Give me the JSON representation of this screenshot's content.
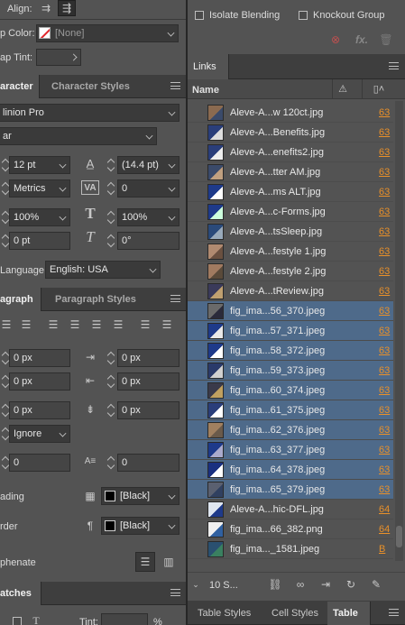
{
  "align": {
    "label": "Align:"
  },
  "gap": {
    "color_label": "p Color:",
    "color_value": "[None]",
    "tint_label": "ap Tint:"
  },
  "character": {
    "tab_active": "aracter",
    "tab_other": "Character Styles",
    "font_family": "linion Pro",
    "font_style": "ar",
    "size": "12 pt",
    "leading": "(14.4 pt)",
    "kerning": "Metrics",
    "tracking": "0",
    "vscale": "100%",
    "hscale": "100%",
    "baseline": "0 pt",
    "skew": "0°",
    "language_label": "Language:",
    "language_value": "English: USA"
  },
  "paragraph": {
    "tab_active": "agraph",
    "tab_other": "Paragraph Styles",
    "left_indent": "0 px",
    "right_indent": "0 px",
    "first_indent": "0 px",
    "last_indent": "0 px",
    "space_before": "0 px",
    "space_after": "0 px",
    "grid_align": "Ignore",
    "dropcap_lines": "0",
    "dropcap_chars": "0",
    "shading_label": "ading",
    "shading_color": "[Black]",
    "border_label": "rder",
    "border_color": "[Black]",
    "hyphenate_label": "phenate"
  },
  "swatches": {
    "tab": "atches",
    "tint_label": "Tint:",
    "percent": "%"
  },
  "effects": {
    "isolate_label": "Isolate Blending",
    "knockout_label": "Knockout Group"
  },
  "links": {
    "tab": "Links",
    "column_name": "Name",
    "rows": [
      {
        "name": "Aleve-A...w 120ct.jpg",
        "page": "63",
        "selected": false
      },
      {
        "name": "Aleve-A...Benefits.jpg",
        "page": "63",
        "selected": false
      },
      {
        "name": "Aleve-A...enefits2.jpg",
        "page": "63",
        "selected": false
      },
      {
        "name": "Aleve-A...tter AM.jpg",
        "page": "63",
        "selected": false
      },
      {
        "name": "Aleve-A...ms ALT.jpg",
        "page": "63",
        "selected": false
      },
      {
        "name": "Aleve-A...c-Forms.jpg",
        "page": "63",
        "selected": false
      },
      {
        "name": "Aleve-A...tsSleep.jpg",
        "page": "63",
        "selected": false
      },
      {
        "name": "Aleve-A...festyle 1.jpg",
        "page": "63",
        "selected": false
      },
      {
        "name": "Aleve-A...festyle 2.jpg",
        "page": "63",
        "selected": false
      },
      {
        "name": "Aleve-A...tReview.jpg",
        "page": "63",
        "selected": false
      },
      {
        "name": "fig_ima...56_370.jpeg",
        "page": "63",
        "selected": true
      },
      {
        "name": "fig_ima...57_371.jpeg",
        "page": "63",
        "selected": true
      },
      {
        "name": "fig_ima...58_372.jpeg",
        "page": "63",
        "selected": true
      },
      {
        "name": "fig_ima...59_373.jpeg",
        "page": "63",
        "selected": true
      },
      {
        "name": "fig_ima...60_374.jpeg",
        "page": "63",
        "selected": true
      },
      {
        "name": "fig_ima...61_375.jpeg",
        "page": "63",
        "selected": true
      },
      {
        "name": "fig_ima...62_376.jpeg",
        "page": "63",
        "selected": true
      },
      {
        "name": "fig_ima...63_377.jpeg",
        "page": "63",
        "selected": true
      },
      {
        "name": "fig_ima...64_378.jpeg",
        "page": "63",
        "selected": true
      },
      {
        "name": "fig_ima...65_379.jpeg",
        "page": "63",
        "selected": true
      },
      {
        "name": "Aleve-A...hic-DFL.jpg",
        "page": "64",
        "selected": false
      },
      {
        "name": "fig_ima...66_382.png",
        "page": "64",
        "selected": false
      },
      {
        "name": "fig_ima..._1581.jpeg",
        "page": "B",
        "selected": false
      }
    ],
    "status": "10 S...",
    "colors": {
      "selected_row": "#4e6a8a",
      "page_link": "#e8902a"
    }
  },
  "bottom_tabs": {
    "table_styles": "Table Styles",
    "cell_styles": "Cell Styles",
    "table": "Table"
  }
}
